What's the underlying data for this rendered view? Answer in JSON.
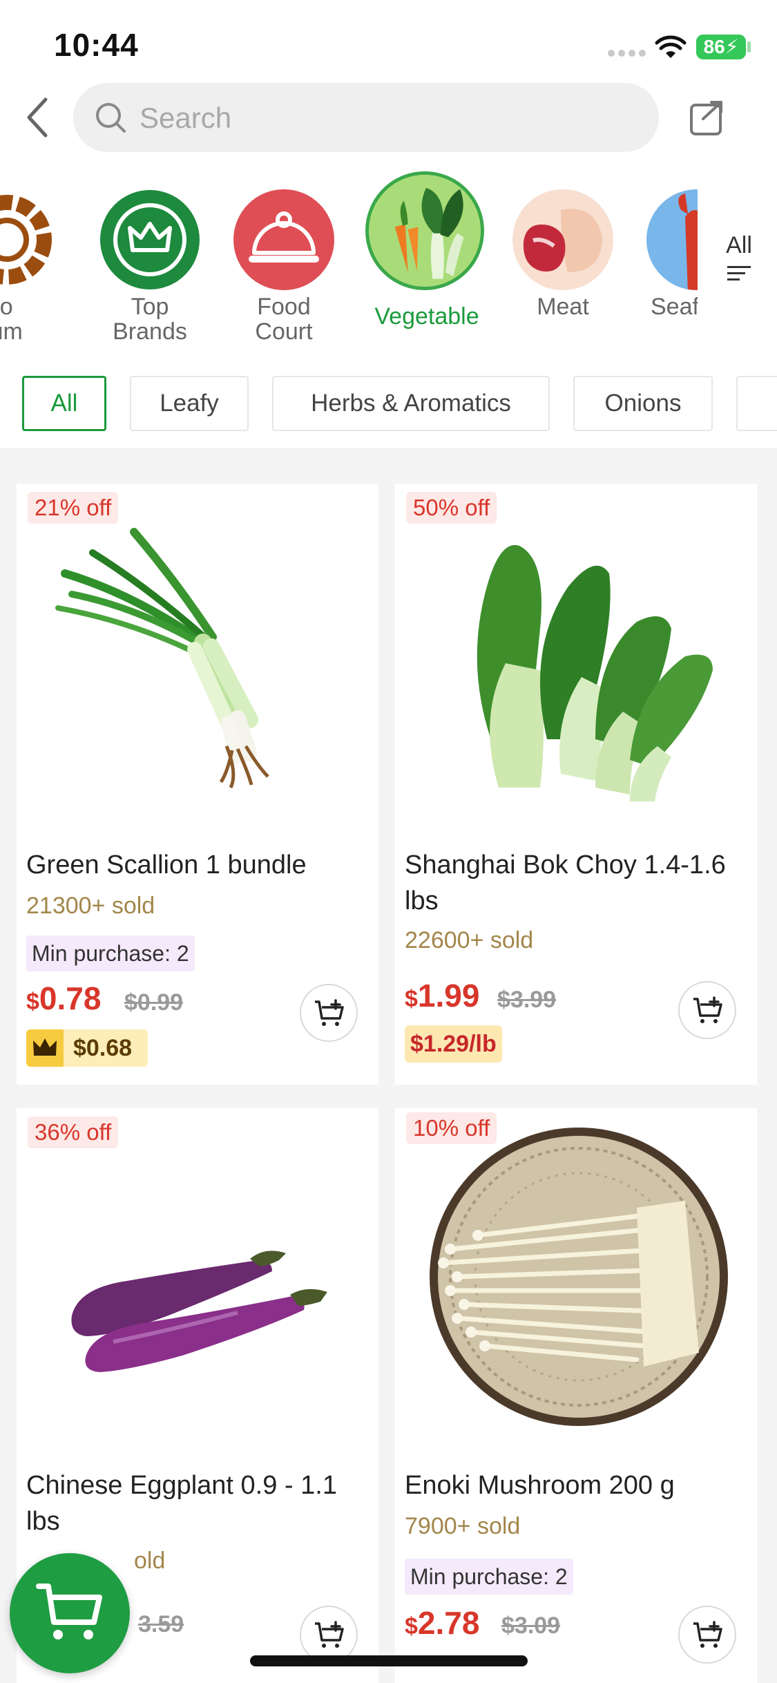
{
  "status_bar": {
    "time": "10:44",
    "battery": "86"
  },
  "search": {
    "placeholder": "Search"
  },
  "categories": [
    {
      "label": "Go\nnium"
    },
    {
      "label": "Top\nBrands"
    },
    {
      "label": "Food\nCourt"
    },
    {
      "label": "Vegetable",
      "active": true
    },
    {
      "label": "Meat"
    },
    {
      "label": "Seaf"
    }
  ],
  "categories_all": "All",
  "filters": [
    "All",
    "Leafy",
    "Herbs & Aromatics",
    "Onions"
  ],
  "products": [
    {
      "discount": "21% off",
      "name": "Green Scallion 1 bundle",
      "sold": "21300+ sold",
      "min_purchase": "Min purchase: 2",
      "currency": "$",
      "price": "0.78",
      "old_price": "$0.99",
      "member_price": "$0.68"
    },
    {
      "discount": "50% off",
      "name": "Shanghai Bok Choy 1.4-1.6 lbs",
      "sold": "22600+ sold",
      "currency": "$",
      "price": "1.99",
      "old_price": "$3.99",
      "unit_price": "$1.29/lb"
    },
    {
      "discount": "36% off",
      "name": "Chinese Eggplant 0.9 - 1.1 lbs",
      "sold": "old",
      "old_price": "3.59"
    },
    {
      "discount": "10% off",
      "name": "Enoki Mushroom 200 g",
      "sold": "7900+ sold",
      "min_purchase": "Min purchase: 2",
      "currency": "$",
      "price": "2.78",
      "old_price": "$3.09"
    }
  ],
  "colors": {
    "brand_green": "#1a9a3c",
    "price_red": "#d8362a",
    "sold_gold": "#a3864b"
  }
}
